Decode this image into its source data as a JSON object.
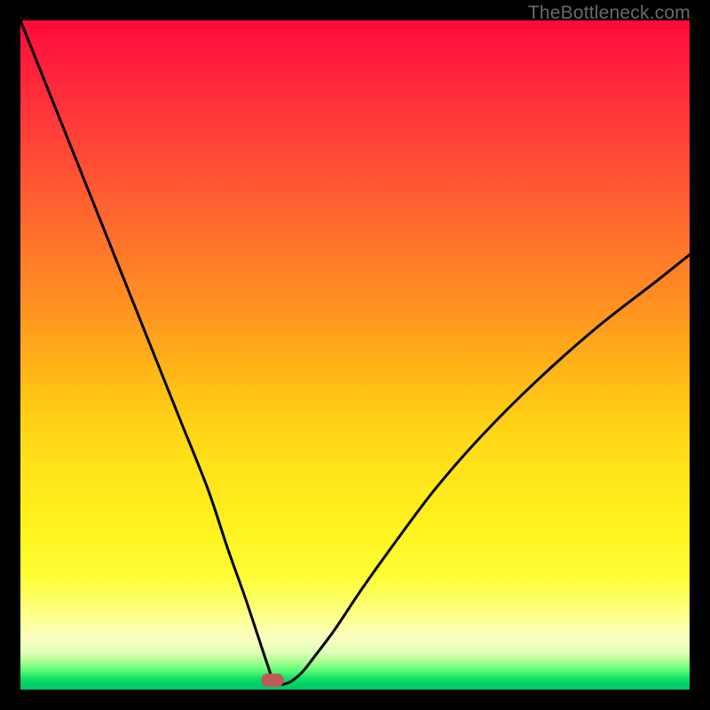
{
  "watermark": "TheBottleneck.com",
  "marker": {
    "x_pct": 37.7,
    "y_pct": 98.6
  },
  "chart_data": {
    "type": "line",
    "title": "",
    "xlabel": "",
    "ylabel": "",
    "xlim": [
      0,
      100
    ],
    "ylim": [
      0,
      100
    ],
    "series": [
      {
        "name": "curve",
        "x": [
          0,
          4,
          8,
          12,
          16,
          20,
          24,
          28,
          31,
          33.5,
          35.5,
          37,
          38,
          40,
          42,
          44,
          47,
          51,
          56,
          62,
          69,
          77,
          86,
          95,
          100
        ],
        "y": [
          100,
          90,
          80,
          70,
          60,
          50,
          40,
          30,
          21,
          14,
          8,
          3.5,
          1,
          1,
          2.5,
          5,
          9,
          15,
          22,
          30,
          38,
          46,
          54,
          61,
          65
        ]
      }
    ],
    "background_gradient_stops": [
      {
        "pct": 0,
        "color": "#ff0a3a"
      },
      {
        "pct": 18,
        "color": "#ff4338"
      },
      {
        "pct": 42,
        "color": "#ff8f22"
      },
      {
        "pct": 68,
        "color": "#ffe51a"
      },
      {
        "pct": 88,
        "color": "#feff7a"
      },
      {
        "pct": 96,
        "color": "#9fff8d"
      },
      {
        "pct": 100,
        "color": "#04c768"
      }
    ]
  }
}
